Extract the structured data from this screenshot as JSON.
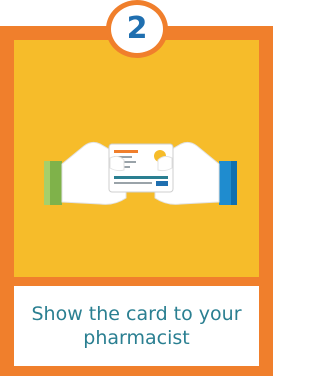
{
  "step": {
    "number": "2"
  },
  "caption": {
    "text": "Show the card to your pharmacist"
  },
  "colors": {
    "frame": "#f07f2c",
    "panel": "#f6bc2a",
    "step_number": "#1f6fb0",
    "caption_text": "#2a7f91",
    "left_cuff": "#7fb24a",
    "right_cuff": "#1f8ccf"
  },
  "icons": {
    "illustration": "hands-holding-card-icon"
  }
}
